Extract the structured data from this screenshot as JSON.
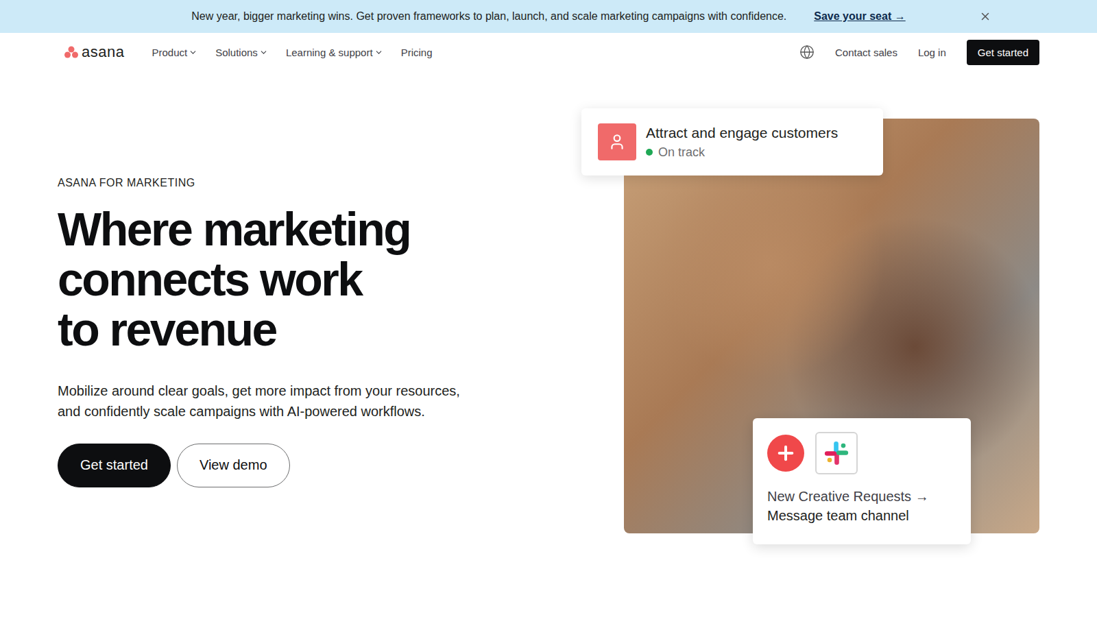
{
  "banner": {
    "text": "New year, bigger marketing wins. Get proven frameworks to plan, launch, and scale marketing campaigns with confidence.",
    "link": "Save your seat →"
  },
  "nav": {
    "logo": "asana",
    "items": [
      {
        "label": "Product",
        "dropdown": true
      },
      {
        "label": "Solutions",
        "dropdown": true
      },
      {
        "label": "Learning & support",
        "dropdown": true
      },
      {
        "label": "Pricing",
        "dropdown": false
      }
    ],
    "contact": "Contact sales",
    "login": "Log in",
    "cta": "Get started"
  },
  "hero": {
    "eyebrow": "ASANA FOR MARKETING",
    "heading": [
      "Where marketing",
      "connects work",
      "to revenue"
    ],
    "body": "Mobilize around clear goals, get more impact from your resources, and confidently scale campaigns with AI-powered workflows.",
    "buttons": [
      {
        "label": "Get started",
        "kind": "primary"
      },
      {
        "label": "View demo",
        "kind": "secondary"
      }
    ]
  },
  "goal_card": {
    "title": "Attract and engage customers",
    "status": "On track"
  },
  "integration_card": {
    "line1": "New Creative Requests →",
    "line2": "Message team channel"
  }
}
